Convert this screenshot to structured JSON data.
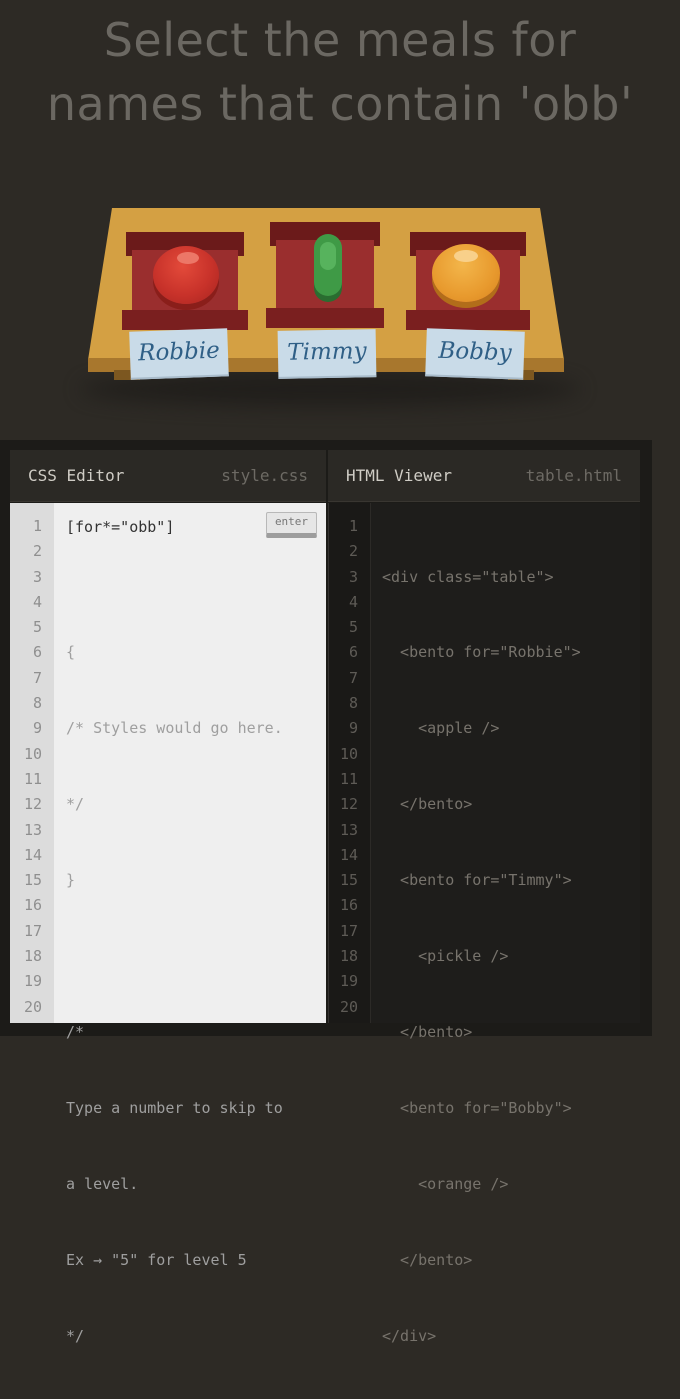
{
  "instruction": {
    "line1": "Select the meals for",
    "line2": "names that contain 'obb'"
  },
  "table": {
    "bentos": [
      {
        "name": "Robbie",
        "food": "apple-icon"
      },
      {
        "name": "Timmy",
        "food": "pickle-icon"
      },
      {
        "name": "Bobby",
        "food": "orange-icon"
      }
    ]
  },
  "css_editor": {
    "title": "CSS Editor",
    "filename": "style.css",
    "input_value": "[for*=\"obb\"]",
    "enter_label": "enter",
    "lines": [
      "{",
      "/* Styles would go here.",
      "*/",
      "}",
      "",
      "/*",
      "Type a number to skip to",
      "a level.",
      "Ex → \"5\" for level 5",
      "*/"
    ],
    "line_numbers": [
      "1",
      "2",
      "3",
      "4",
      "5",
      "6",
      "7",
      "8",
      "9",
      "10",
      "11",
      "12",
      "13",
      "14",
      "15",
      "16",
      "17",
      "18",
      "19",
      "20"
    ]
  },
  "html_viewer": {
    "title": "HTML Viewer",
    "filename": "table.html",
    "lines": [
      "<div class=\"table\">",
      "  <bento for=\"Robbie\">",
      "    <apple />",
      "  </bento>",
      "  <bento for=\"Timmy\">",
      "    <pickle />",
      "  </bento>",
      "  <bento for=\"Bobby\">",
      "    <orange />",
      "  </bento>",
      "</div>"
    ],
    "line_numbers": [
      "1",
      "2",
      "3",
      "4",
      "5",
      "6",
      "7",
      "8",
      "9",
      "10",
      "11",
      "12",
      "13",
      "14",
      "15",
      "16",
      "17",
      "18",
      "19",
      "20"
    ]
  }
}
